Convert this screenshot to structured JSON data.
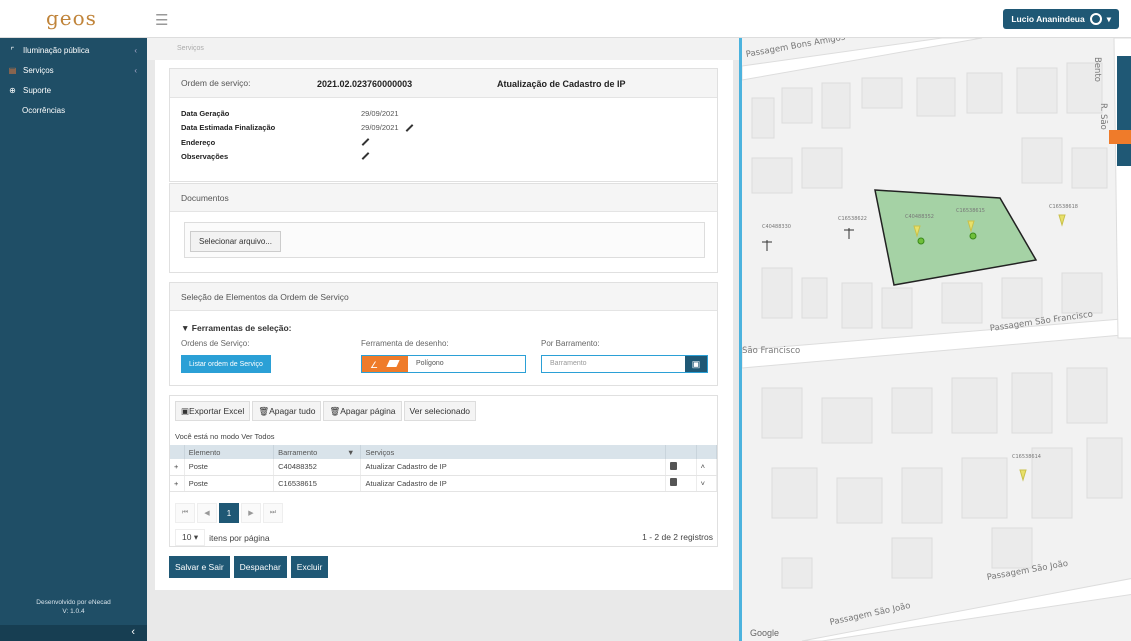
{
  "header": {
    "logo": "geos",
    "user_name": "Lucio Ananindeua"
  },
  "sidebar": {
    "items": [
      {
        "label": "Iluminação pública"
      },
      {
        "label": "Serviços"
      },
      {
        "label": "Suporte"
      },
      {
        "label": "Ocorrências"
      }
    ],
    "footer_line1": "Desenvolvido por eNecad",
    "footer_line2": "V: 1.0.4"
  },
  "breadcrumb": "Serviços",
  "order": {
    "label": "Ordem de serviço:",
    "number": "2021.02.023760000003",
    "title": "Atualização de Cadastro de IP",
    "data_geracao_label": "Data Geração",
    "data_geracao": "29/09/2021",
    "data_estimada_label": "Data Estimada Finalização",
    "data_estimada": "29/09/2021",
    "endereco_label": "Endereço",
    "observacoes_label": "Observações"
  },
  "documents": {
    "title": "Documentos",
    "select_button": "Selecionar arquivo..."
  },
  "selection": {
    "title": "Seleção de Elementos da Ordem de Serviço",
    "tools_title": "Ferramentas de seleção:",
    "orders_label": "Ordens de Serviço:",
    "list_button": "Listar ordem de Serviço",
    "draw_label": "Ferramenta de desenho:",
    "draw_value": "Polígono",
    "barramento_label": "Por Barramento:",
    "barramento_placeholder": "Barramento"
  },
  "grid": {
    "toolbar": [
      "Exportar Excel",
      "Apagar tudo",
      "Apagar página",
      "Ver selecionado"
    ],
    "mode_text": "Você está no modo Ver Todos",
    "columns": [
      "Elemento",
      "Barramento",
      "Serviços"
    ],
    "rows": [
      {
        "elemento": "Poste",
        "barramento": "C40488352",
        "servico": "Atualizar Cadastro de IP"
      },
      {
        "elemento": "Poste",
        "barramento": "C16538615",
        "servico": "Atualizar Cadastro de IP"
      }
    ],
    "current_page": "1",
    "per_page": "10",
    "per_page_label": "itens por página",
    "range": "1 - 2 de 2 registros"
  },
  "actions": {
    "save": "Salvar e Sair",
    "dispatch": "Despachar",
    "delete": "Excluir"
  },
  "map": {
    "streets": [
      "Passagem Bons Amigos",
      "Passagem São Francisco",
      "São Francisco",
      "Passagem São João",
      "Passagem São João",
      "Bento",
      "R. São"
    ],
    "poles": [
      "C40488330",
      "C16538622",
      "C40488352",
      "C16538615",
      "C16538618",
      "C16538614"
    ],
    "attribution": "Google"
  }
}
